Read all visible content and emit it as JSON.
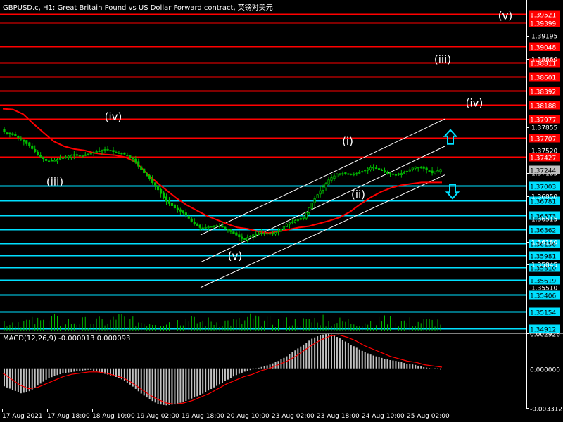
{
  "header": {
    "title": "GBPUSD.c, H1:  Great Britain Pound vs US Dollar Forward contract, 英镑对美元"
  },
  "colors": {
    "background": "#000000",
    "candle": "#00c000",
    "resistance_line": "#ff0000",
    "support_line": "#00e0ff",
    "ma_line": "#ff0000",
    "channel_line": "#ffffff",
    "price_label_red": "#ff0000",
    "price_label_cyan": "#00e0ff",
    "current_price_label": "#c0c0c0",
    "macd_histogram": "#c0c0c0",
    "macd_signal": "#ff0000",
    "volume": "#00c000"
  },
  "chart_data": {
    "type": "candlestick",
    "symbol": "GBPUSD.c",
    "timeframe": "H1",
    "current_price": 1.37244,
    "price_axis_ticks": [
      1.39195,
      1.3886,
      1.37855,
      1.3752,
      1.37185,
      1.3685,
      1.36515,
      1.3618,
      1.35845,
      1.3551
    ],
    "resistance_levels": [
      1.39521,
      1.39399,
      1.39048,
      1.38811,
      1.38601,
      1.38392,
      1.38188,
      1.37977,
      1.37707,
      1.37427
    ],
    "support_levels": [
      1.37003,
      1.36781,
      1.36573,
      1.36362,
      1.36156,
      1.35981,
      1.3581,
      1.35619,
      1.35406,
      1.35154,
      1.34912
    ],
    "time_axis_labels": [
      "17 Aug 2021",
      "17 Aug 18:00",
      "18 Aug 10:00",
      "19 Aug 02:00",
      "19 Aug 18:00",
      "20 Aug 10:00",
      "23 Aug 02:00",
      "23 Aug 18:00",
      "24 Aug 10:00",
      "25 Aug 02:00"
    ],
    "wave_labels": [
      "(iv)",
      "(iii)",
      "(v)",
      "(i)",
      "(ii)",
      "(iii)",
      "(iv)",
      "(v)"
    ],
    "series": [
      {
        "name": "close",
        "values": [
          1.3779,
          1.3775,
          1.3768,
          1.3758,
          1.3745,
          1.3736,
          1.3738,
          1.3742,
          1.3745,
          1.3744,
          1.3747,
          1.3751,
          1.3754,
          1.3749,
          1.3747,
          1.374,
          1.3724,
          1.371,
          1.3694,
          1.3677,
          1.3667,
          1.366,
          1.3647,
          1.3638,
          1.364,
          1.3642,
          1.3637,
          1.3629,
          1.3621,
          1.3628,
          1.3631,
          1.3629,
          1.3633,
          1.3644,
          1.3649,
          1.3654,
          1.3676,
          1.3694,
          1.371,
          1.3718,
          1.3718,
          1.3717,
          1.3722,
          1.3728,
          1.3723,
          1.3718,
          1.3716,
          1.3721,
          1.3728,
          1.3726,
          1.3719,
          1.3724
        ]
      },
      {
        "name": "moving_average",
        "values": [
          1.3813,
          1.3812,
          1.3805,
          1.3791,
          1.3778,
          1.3765,
          1.3758,
          1.3754,
          1.3752,
          1.3748,
          1.3746,
          1.3745,
          1.3742,
          1.3735,
          1.372,
          1.3706,
          1.3694,
          1.3682,
          1.3672,
          1.3664,
          1.3656,
          1.365,
          1.3644,
          1.3639,
          1.3637,
          1.3633,
          1.3631,
          1.3633,
          1.3636,
          1.3639,
          1.3641,
          1.3645,
          1.3649,
          1.3654,
          1.3662,
          1.3673,
          1.3683,
          1.3691,
          1.3697,
          1.3701,
          1.3703,
          1.3705,
          1.3705,
          1.3705
        ]
      }
    ],
    "volume_bars": 157,
    "macd": {
      "label": "MACD(12,26,9) -0.000013 0.000093",
      "ticks": [
        0.002926,
        0.0,
        -0.003312
      ],
      "ylim": [
        -0.003312,
        0.002926
      ],
      "histogram": [
        -0.0015,
        -0.0018,
        -0.0021,
        -0.0019,
        -0.0014,
        -0.0009,
        -0.0006,
        -0.0004,
        -0.0003,
        -0.0002,
        -0.0001,
        -0.0003,
        -0.0005,
        -0.0007,
        -0.001,
        -0.0015,
        -0.0021,
        -0.0026,
        -0.003,
        -0.0031,
        -0.003,
        -0.0028,
        -0.0025,
        -0.0022,
        -0.0018,
        -0.0014,
        -0.001,
        -0.0006,
        -0.0003,
        -0.0001,
        0.0001,
        0.0003,
        0.0006,
        0.001,
        0.0015,
        0.002,
        0.0025,
        0.0028,
        0.0029,
        0.0026,
        0.0022,
        0.0018,
        0.0014,
        0.0011,
        0.0009,
        0.0007,
        0.0006,
        0.0004,
        0.0003,
        0.0001,
        0.0,
        -0.0001
      ],
      "signal": [
        -0.0004,
        -0.0009,
        -0.0014,
        -0.0017,
        -0.0016,
        -0.0013,
        -0.001,
        -0.0007,
        -0.0005,
        -0.0004,
        -0.0003,
        -0.0003,
        -0.0004,
        -0.0006,
        -0.0008,
        -0.0012,
        -0.0017,
        -0.0022,
        -0.0026,
        -0.0029,
        -0.003,
        -0.0029,
        -0.0027,
        -0.0024,
        -0.0021,
        -0.0017,
        -0.0013,
        -0.001,
        -0.0007,
        -0.0005,
        -0.0002,
        0.0,
        0.0003,
        0.0006,
        0.001,
        0.0015,
        0.002,
        0.0024,
        0.0027,
        0.0028,
        0.0026,
        0.0023,
        0.0019,
        0.0016,
        0.0013,
        0.001,
        0.0008,
        0.0006,
        0.0005,
        0.0003,
        0.0002,
        0.0001
      ]
    }
  }
}
